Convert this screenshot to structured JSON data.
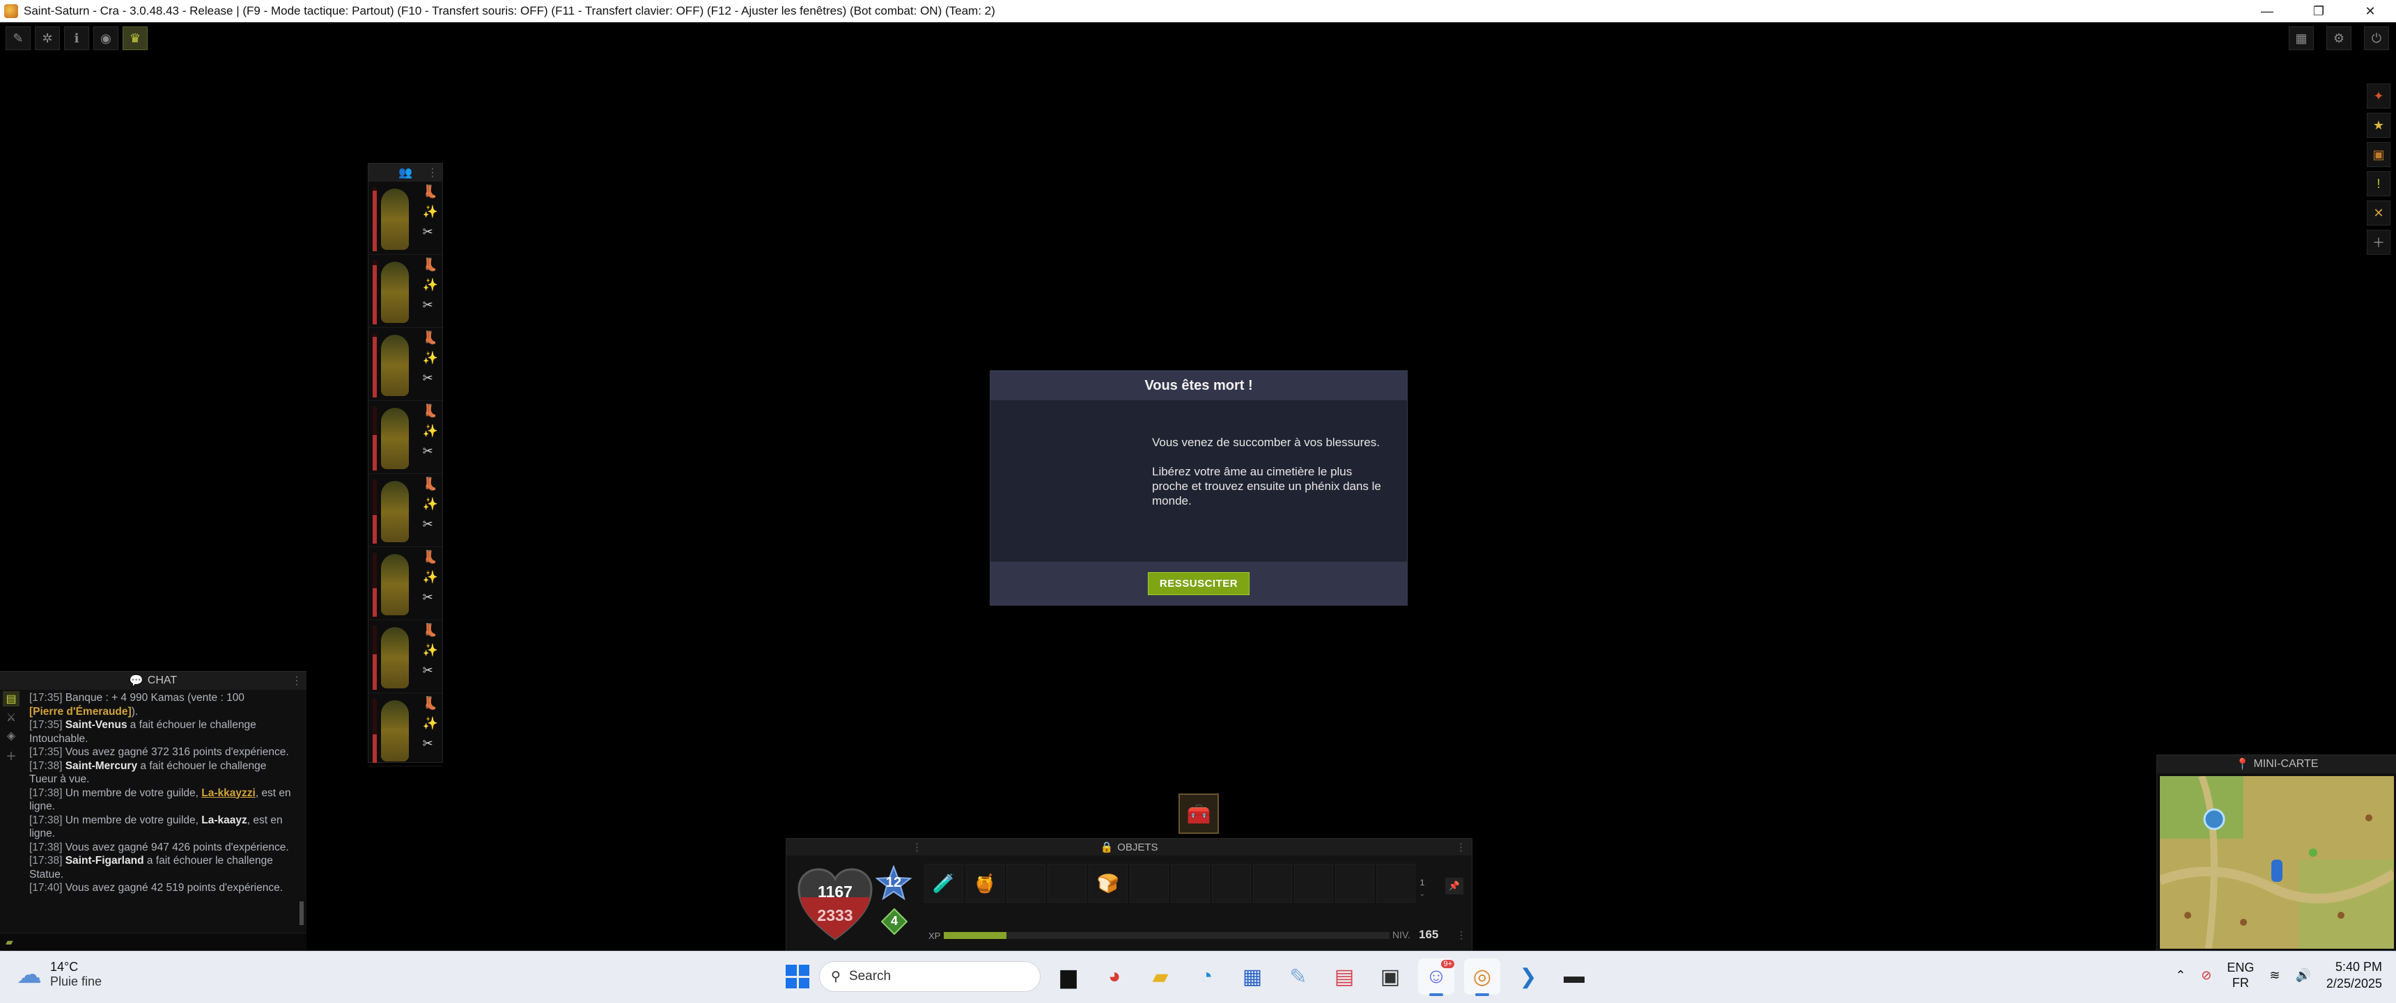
{
  "window": {
    "title": "Saint-Saturn - Cra - 3.0.48.43 - Release | (F9 - Mode tactique: Partout) (F10 - Transfert souris: OFF) (F11 - Transfert clavier: OFF) (F12 - Ajuster les fenêtres) (Bot combat: ON) (Team: 2)",
    "minimize": "—",
    "restore": "❐",
    "close": "✕"
  },
  "team": {
    "member_hp": [
      0.95,
      0.92,
      0.95,
      0.55,
      0.45,
      0.45,
      0.55,
      0.45
    ]
  },
  "chat": {
    "title": "CHAT",
    "lines": [
      {
        "ts": "[17:35]",
        "pre": " Banque : + 4 990 Kamas (vente : 100",
        "bold": "",
        "post": ""
      },
      {
        "ts": "",
        "pre": "",
        "bold": "[Pierre d'Émeraude]",
        "post": ")."
      },
      {
        "ts": "[17:35]",
        "pre": " ",
        "bold": "Saint-Venus",
        "post": " a fait échouer le challenge Intouchable."
      },
      {
        "ts": "[17:35]",
        "pre": " Vous avez gagné 372 316 points d'expérience.",
        "bold": "",
        "post": ""
      },
      {
        "ts": "[17:38]",
        "pre": " ",
        "bold": "Saint-Mercury",
        "post": " a fait échouer le challenge Tueur à vue."
      },
      {
        "ts": "[17:38]",
        "pre": " Un membre de votre guilde, ",
        "bold": "La-kkayzzi",
        "post": ", est en ligne."
      },
      {
        "ts": "[17:38]",
        "pre": " Un membre de votre guilde, ",
        "bold": "La-kaayz",
        "post": ", est en ligne."
      },
      {
        "ts": "[17:38]",
        "pre": " Vous avez gagné 947 426 points d'expérience.",
        "bold": "",
        "post": ""
      },
      {
        "ts": "[17:38]",
        "pre": " ",
        "bold": "Saint-Figarland",
        "post": " a fait échouer le challenge Statue."
      },
      {
        "ts": "[17:40]",
        "pre": " Vous avez gagné 42 519 points d'expérience.",
        "bold": "",
        "post": ""
      }
    ]
  },
  "death_modal": {
    "title": "Vous êtes mort !",
    "paragraph1": "Vous venez de succomber à vos blessures.",
    "paragraph2": "Libérez votre âme au cimetière le plus proche et trouvez ensuite un phénix dans le monde.",
    "button": "RESSUSCITER"
  },
  "bottom_bar": {
    "title": "OBJETS",
    "hp_current": "1167",
    "hp_max": "2333",
    "ap": "12",
    "mp": "4",
    "page": "1",
    "xp_label": "XP",
    "xp_fraction": 0.14,
    "level_label": "NIV.",
    "level": "165"
  },
  "minimap": {
    "title": "MINI-CARTE"
  },
  "taskbar": {
    "temperature": "14°C",
    "weather": "Pluie fine",
    "search_placeholder": "Search",
    "lang1": "ENG",
    "lang2": "FR",
    "time": "5:40 PM",
    "date": "2/25/2025",
    "discord_badge": "9+"
  },
  "colors": {
    "modal_bg": "#202331",
    "modal_header": "#33364a",
    "accent_green": "#7fa414",
    "hp_red": "#b53030"
  }
}
